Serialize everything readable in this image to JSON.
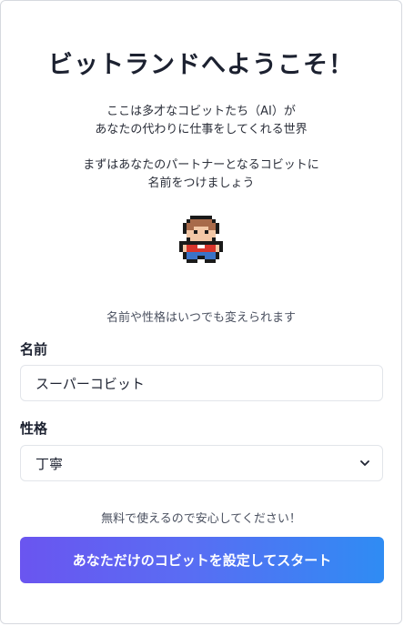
{
  "title": "ビットランドへようこそ！",
  "intro": {
    "line1": "ここは多才なコビットたち（AI）が",
    "line2": "あなたの代わりに仕事をしてくれる世界",
    "line3": "まずはあなたのパートナーとなるコビットに",
    "line4": "名前をつけましょう"
  },
  "character": {
    "icon": "pixel-character-kobit"
  },
  "change_note": "名前や性格はいつでも変えられます",
  "form": {
    "name_label": "名前",
    "name_value": "スーパーコビット",
    "personality_label": "性格",
    "personality_value": "丁寧"
  },
  "free_note": "無料で使えるので安心してください！",
  "cta_label": "あなただけのコビットを設定してスタート",
  "colors": {
    "gradient_start": "#6a55f0",
    "gradient_end": "#2f8cf3",
    "text": "#1c2130"
  }
}
